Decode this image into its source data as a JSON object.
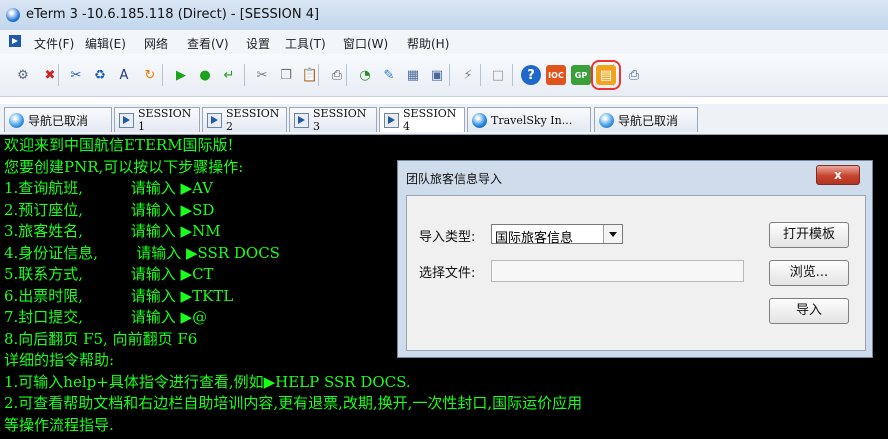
{
  "window": {
    "title": "eTerm 3 -10.6.185.118 (Direct) - [SESSION 4]"
  },
  "menu": [
    "文件(F)",
    "编辑(E)",
    "网络",
    "查看(V)",
    "设置",
    "工具(T)",
    "窗口(W)",
    "帮助(H)"
  ],
  "toolbar_icons": [
    {
      "name": "connect-icon",
      "glyph": "⚙",
      "color": "#5a6b80"
    },
    {
      "name": "disconnect-icon",
      "glyph": "✖",
      "color": "#c22"
    },
    {
      "name": "cut-cross-icon",
      "glyph": "✂",
      "color": "#1a5ab0"
    },
    {
      "name": "recycle-icon",
      "glyph": "♻",
      "color": "#1a5ab0"
    },
    {
      "name": "text-a-icon",
      "glyph": "A",
      "color": "#1a3a80"
    },
    {
      "name": "refresh-icon",
      "glyph": "↻",
      "color": "#e67c00"
    },
    {
      "name": "play-icon",
      "glyph": "▶",
      "color": "#1aa21a"
    },
    {
      "name": "record-icon",
      "glyph": "●",
      "color": "#1aa21a"
    },
    {
      "name": "enter-icon",
      "glyph": "↵",
      "color": "#1aa21a"
    },
    {
      "name": "scissors-icon",
      "glyph": "✂",
      "color": "#777"
    },
    {
      "name": "copy-icon",
      "glyph": "❐",
      "color": "#777"
    },
    {
      "name": "paste-icon",
      "glyph": "📋",
      "color": "#777"
    },
    {
      "name": "print-icon",
      "glyph": "⎙",
      "color": "#555"
    },
    {
      "name": "chart-icon",
      "glyph": "◔",
      "color": "#2a8a2a"
    },
    {
      "name": "edit-icon",
      "glyph": "✎",
      "color": "#2a7ad0"
    },
    {
      "name": "calc-icon",
      "glyph": "▦",
      "color": "#4a6a9a"
    },
    {
      "name": "window-icon",
      "glyph": "▣",
      "color": "#4a6a9a"
    },
    {
      "name": "plug-icon",
      "glyph": "⚡",
      "color": "#888"
    },
    {
      "name": "blank-page-icon",
      "glyph": "□",
      "color": "#999"
    },
    {
      "name": "help-icon",
      "glyph": "?",
      "color": "#fff"
    },
    {
      "name": "ioc-icon",
      "glyph": "IOC",
      "color": "#fff"
    },
    {
      "name": "gp-icon",
      "glyph": "GP",
      "color": "#fff"
    },
    {
      "name": "group-import-icon",
      "glyph": "▤",
      "color": "#fff"
    },
    {
      "name": "printer-icon",
      "glyph": "⎙",
      "color": "#3a5a8a"
    }
  ],
  "tabs": [
    {
      "label": "导航已取消",
      "icon": "globe",
      "active": false
    },
    {
      "label": "SESSION 1",
      "icon": "session",
      "active": false
    },
    {
      "label": "SESSION 2",
      "icon": "session",
      "active": false
    },
    {
      "label": "SESSION 3",
      "icon": "session",
      "active": false
    },
    {
      "label": "SESSION 4",
      "icon": "session",
      "active": true
    },
    {
      "label": "TravelSky In...",
      "icon": "travel",
      "active": false
    },
    {
      "label": "导航已取消",
      "icon": "globe",
      "active": false
    }
  ],
  "terminal": {
    "lines": [
      "欢迎来到中国航信ETERM国际版!",
      "您要创建PNR,可以按以下步骤操作:",
      "1.查询航班,          请输入 ▶AV",
      "2.预订座位,          请输入 ▶SD",
      "3.旅客姓名,          请输入 ▶NM",
      "4.身份证信息,        请输入 ▶SSR DOCS",
      "5.联系方式,          请输入 ▶CT",
      "6.出票时限,          请输入 ▶TKTL",
      "7.封口提交,          请输入 ▶@",
      "8.向后翻页 F5, 向前翻页 F6",
      "详细的指令帮助:",
      "1.可输入help+具体指令进行查看,例如▶HELP SSR DOCS.",
      "2.可查看帮助文档和右边栏自助培训内容,更有退票,改期,换开,一次性封口,国际运价应用",
      "等操作流程指导."
    ]
  },
  "dialog": {
    "title": "团队旅客信息导入",
    "close_label": "x",
    "import_type_label": "导入类型:",
    "import_type_value": "国际旅客信息",
    "file_label": "选择文件:",
    "file_value": "",
    "open_template_label": "打开模板",
    "browse_label": "浏览...",
    "import_label": "导入"
  }
}
